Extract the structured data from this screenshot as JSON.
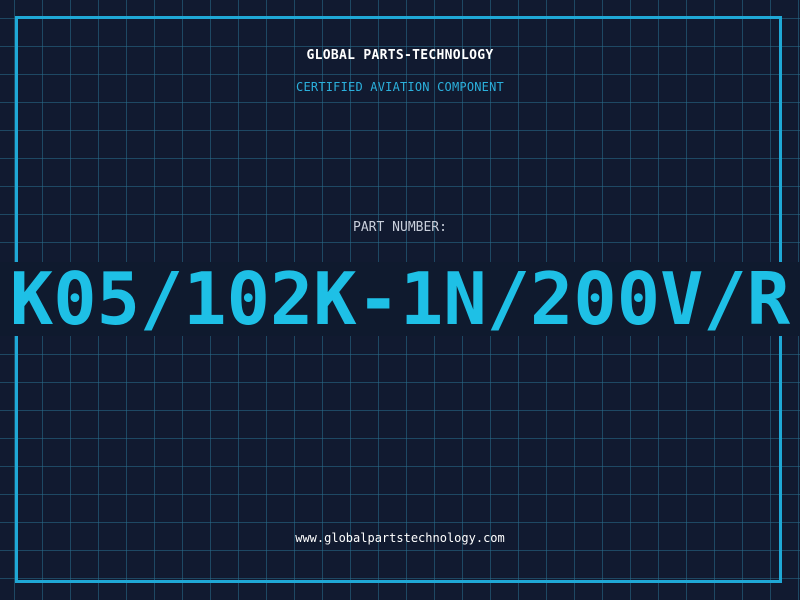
{
  "header": {
    "company": "GLOBAL PARTS-TECHNOLOGY",
    "tagline": "CERTIFIED AVIATION COMPONENT"
  },
  "part": {
    "label": "PART NUMBER:",
    "number": "K05/102K-1N/200V/R"
  },
  "footer": {
    "url": "www.globalpartstechnology.com"
  },
  "colors": {
    "background": "#111a30",
    "grid": "#286e8c",
    "accent": "#1fa8d6",
    "part_number": "#1ec0e6",
    "text": "#ffffff"
  }
}
